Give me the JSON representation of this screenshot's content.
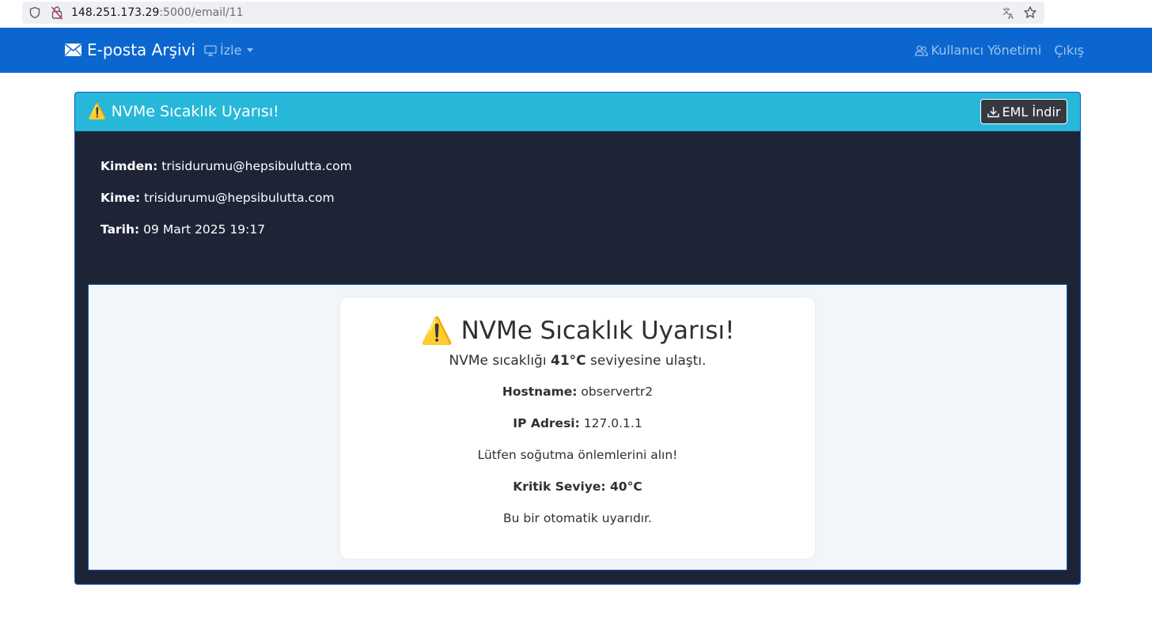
{
  "browser": {
    "url_host": "148.251.173.29",
    "url_path": ":5000/email/11"
  },
  "navbar": {
    "brand": "E-posta Arşivi",
    "menu_izle": "İzle",
    "users_link": "Kullanıcı Yönetimi",
    "logout_link": "Çıkış",
    "color": "#0b66d0"
  },
  "email": {
    "subject": "NVMe Sıcaklık Uyarısı!",
    "download_label": "EML İndir",
    "from_label": "Kimden:",
    "from_value": "trisidurumu@hepsibulutta.com",
    "to_label": "Kime:",
    "to_value": "trisidurumu@hepsibulutta.com",
    "date_label": "Tarih:",
    "date_value": "09 Mart 2025 19:17"
  },
  "body": {
    "heading": "NVMe Sıcaklık Uyarısı!",
    "lead_pre": "NVMe sıcaklığı ",
    "lead_temp": "41°C",
    "lead_post": " seviyesine ulaştı.",
    "hostname_label": "Hostname:",
    "hostname_value": "observertr2",
    "ip_label": "IP Adresi:",
    "ip_value": "127.0.1.1",
    "advice": "Lütfen soğutma önlemlerini alın!",
    "critical": "Kritik Seviye: 40°C",
    "footer": "Bu bir otomatik uyarıdır."
  },
  "icons": {
    "warning": "⚠️"
  }
}
